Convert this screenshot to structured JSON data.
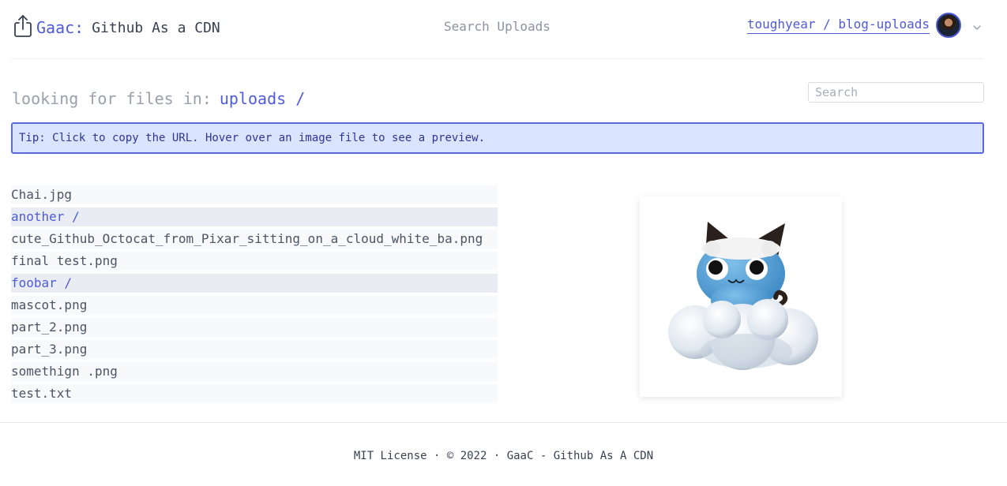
{
  "header": {
    "brand_accent": "Gaac:",
    "brand_rest": "Github As a CDN",
    "search_uploads_label": "Search Uploads",
    "repo_label": "toughyear / blog-uploads"
  },
  "main": {
    "path_label": "looking for files in:",
    "path_current": "uploads /",
    "search_placeholder": "Search",
    "tip": "Tip: Click to copy the URL. Hover over an image file to see a preview."
  },
  "files": [
    {
      "name": "Chai.jpg",
      "type": "file"
    },
    {
      "name": "another /",
      "type": "dir"
    },
    {
      "name": "cute_Github_Octocat_from_Pixar_sitting_on_a_cloud_white_ba.png",
      "type": "file"
    },
    {
      "name": "final test.png",
      "type": "file"
    },
    {
      "name": "foobar /",
      "type": "dir"
    },
    {
      "name": "mascot.png",
      "type": "file"
    },
    {
      "name": "part_2.png",
      "type": "file"
    },
    {
      "name": "part_3.png",
      "type": "file"
    },
    {
      "name": "somethign .png",
      "type": "file"
    },
    {
      "name": "test.txt",
      "type": "file"
    }
  ],
  "footer": {
    "text": "MIT License · © 2022 · GaaC - Github As A CDN"
  },
  "colors": {
    "accent": "#4f5bd5",
    "tip_bg": "#dbe4ff",
    "tip_border": "#5c6ad8"
  },
  "icons": {
    "brand": "share-upload-icon",
    "dropdown": "chevron-down-icon"
  }
}
